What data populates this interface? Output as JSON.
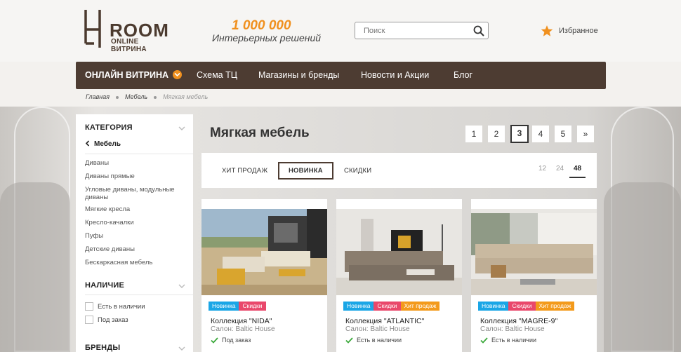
{
  "brand": {
    "logo_name": "ROOM",
    "logo_sub": "ONLINE ВИТРИНА",
    "slogan_number": "1 000 000",
    "slogan_text": "Интерьерных решений"
  },
  "search": {
    "placeholder": "Поиск",
    "icon": "search-icon"
  },
  "favorites": {
    "label": "Избранное",
    "icon": "star-icon",
    "color": "#f0901e"
  },
  "nav": {
    "items": [
      {
        "label": "ОНЛАЙН ВИТРИНА",
        "active": true
      },
      {
        "label": "Схема ТЦ"
      },
      {
        "label": "Магазины и бренды"
      },
      {
        "label": "Новости и Акции"
      },
      {
        "label": "Блог"
      }
    ]
  },
  "breadcrumb": [
    "Главная",
    "Мебель",
    "Мягкая мебель"
  ],
  "sidebar": {
    "category_title": "КАТЕГОРИЯ",
    "back_label": "Мебель",
    "links": [
      "Диваны",
      "Диваны прямые",
      "Угловые диваны, модульные диваны",
      "Мягкие кресла",
      "Кресло-качалки",
      "Пуфы",
      "Детские диваны",
      "Бескаркасная мебель"
    ],
    "availability_title": "НАЛИЧИЕ",
    "availability": [
      "Есть в наличии",
      "Под заказ"
    ],
    "brands_title": "БРЕНДЫ"
  },
  "main": {
    "title": "Мягкая мебель",
    "pages": [
      "1",
      "2",
      "3",
      "4",
      "5",
      "»"
    ],
    "current_page": "3",
    "filters": [
      "ХИТ ПРОДАЖ",
      "НОВИНКА",
      "СКИДКИ"
    ],
    "active_filter": "НОВИНКА",
    "per_page": [
      "12",
      "24",
      "48"
    ],
    "active_per_page": "48"
  },
  "products": [
    {
      "badges": [
        "Новинка",
        "Скидки"
      ],
      "name": "Коллекция \"NIDA\"",
      "shop": "Салон: Baltic House",
      "stock": "Под заказ"
    },
    {
      "badges": [
        "Новинка",
        "Скидки",
        "Хит продаж"
      ],
      "name": "Коллекция \"ATLANTIC\"",
      "shop": "Салон: Baltic House",
      "stock": "Есть в наличии"
    },
    {
      "badges": [
        "Новинка",
        "Скидки",
        "Хит продаж"
      ],
      "name": "Коллекция \"MAGRE-9\"",
      "shop": "Салон: Baltic House",
      "stock": "Есть в наличии"
    }
  ],
  "colors": {
    "nav_bg": "#4d3c32",
    "accent": "#f0901e",
    "badge_new": "#1aa6e6",
    "badge_sale": "#e9486b",
    "badge_hit": "#f39a1b",
    "check": "#3aa83a"
  }
}
